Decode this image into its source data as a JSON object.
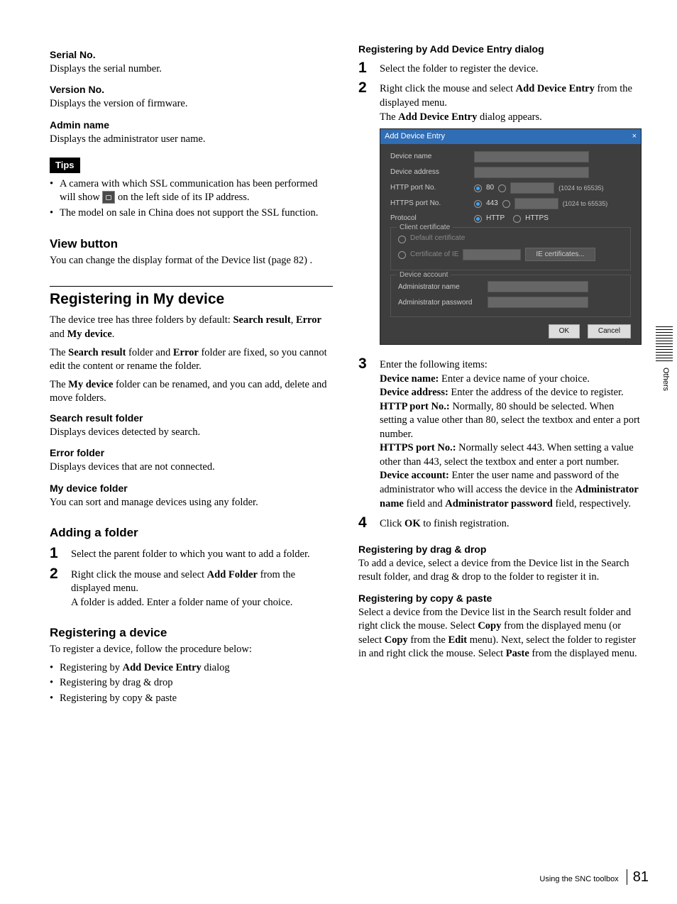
{
  "left": {
    "serial_no": {
      "term": "Serial No.",
      "body": "Displays the serial number."
    },
    "version_no": {
      "term": "Version No.",
      "body": "Displays the version of firmware."
    },
    "admin_name": {
      "term": "Admin name",
      "body": "Displays the administrator user name."
    },
    "tips_label": "Tips",
    "tips": {
      "item1_a": "A camera with which SSL communication has been performed will show ",
      "item1_b": " on the left side of its IP address.",
      "item2": "The model on sale in China does not support the SSL function."
    },
    "view_button": {
      "title": "View button",
      "body": "You can change the display format of the Device list (page 82) ."
    },
    "reg_my_device": {
      "title": "Registering in My device",
      "p1_a": "The device tree has three folders by default: ",
      "p1_b": "Search result",
      "p1_c": ", ",
      "p1_d": "Error",
      "p1_e": " and ",
      "p1_f": "My device",
      "p1_g": ".",
      "p2_a": "The ",
      "p2_b": "Search result",
      "p2_c": " folder and ",
      "p2_d": "Error",
      "p2_e": " folder are fixed, so you cannot edit the content or rename the folder.",
      "p3_a": "The ",
      "p3_b": "My device",
      "p3_c": " folder can be renamed, and you can add, delete and move folders."
    },
    "search_folder": {
      "term": "Search result folder",
      "body": "Displays devices detected by search."
    },
    "error_folder": {
      "term": "Error folder",
      "body": "Displays devices that are not connected."
    },
    "my_device_folder": {
      "term": "My device folder",
      "body": "You can sort and manage devices using any folder."
    },
    "adding_folder": {
      "title": "Adding a folder",
      "step1": "Select the parent folder to which you want to add a folder.",
      "step2_a": "Right click the mouse and select ",
      "step2_b": "Add Folder",
      "step2_c": " from the displayed menu.",
      "step2_d": "A folder is added. Enter a folder name of your choice."
    },
    "reg_device": {
      "title": "Registering a device",
      "intro": "To register a device, follow the procedure below:",
      "b1_a": "Registering by ",
      "b1_b": "Add Device Entry",
      "b1_c": " dialog",
      "b2": "Registering by drag & drop",
      "b3": "Registering by copy & paste"
    }
  },
  "right": {
    "reg_add_dialog": {
      "title": "Registering by Add Device Entry dialog",
      "step1": "Select the folder to register the device.",
      "step2_a": "Right click the mouse and select ",
      "step2_b": "Add Device Entry",
      "step2_c": " from the displayed menu.",
      "step2_d_a": "The ",
      "step2_d_b": "Add Device Entry",
      "step2_d_c": " dialog appears.",
      "step3_intro": "Enter the following items:",
      "step3_dn_a": "Device name:",
      "step3_dn_b": " Enter a device name of your choice.",
      "step3_da_a": "Device address:",
      "step3_da_b": " Enter the address of the device to register.",
      "step3_http_a": "HTTP port No.:",
      "step3_http_b": " Normally, 80 should be selected. When setting a value other than 80, select the textbox and enter a port number.",
      "step3_https_a": "HTTPS port No.:",
      "step3_https_b": " Normally select 443. When setting a value other than 443, select the textbox and enter a port number.",
      "step3_acc_a": "Device account:",
      "step3_acc_b": " Enter the user name and password of the administrator who will access the device in the ",
      "step3_acc_c": "Administrator name",
      "step3_acc_d": " field and ",
      "step3_acc_e": "Administrator password",
      "step3_acc_f": " field, respectively.",
      "step4_a": "Click ",
      "step4_b": "OK",
      "step4_c": " to finish registration."
    },
    "reg_dragdrop": {
      "title": "Registering by drag & drop",
      "body": "To add a device, select a device from the Device list in the Search result folder, and drag & drop to the folder to register it in."
    },
    "reg_copypaste": {
      "title": "Registering by copy & paste",
      "a": "Select a device from the Device list in the Search result folder and right click the mouse. Select ",
      "b": "Copy",
      "c": " from the displayed menu (or select ",
      "d": "Copy",
      "e": " from the ",
      "f": "Edit",
      "g": " menu). Next, select the folder to register in and right click the mouse. Select ",
      "h": "Paste",
      "i": " from the displayed menu."
    }
  },
  "dialog": {
    "title": "Add Device Entry",
    "close": "×",
    "device_name": "Device name",
    "device_address": "Device address",
    "http_port": "HTTP port No.",
    "http_val": "80",
    "https_port": "HTTPS port No.",
    "https_val": "443",
    "range": "(1024 to 65535)",
    "protocol": "Protocol",
    "proto_http": "HTTP",
    "proto_https": "HTTPS",
    "client_cert": "Client certificate",
    "default_cert": "Default certificate",
    "cert_of_ie": "Certificate of IE",
    "ie_cert_btn": "IE certificates...",
    "device_account": "Device account",
    "admin_name": "Administrator name",
    "admin_pw": "Administrator password",
    "ok": "OK",
    "cancel": "Cancel"
  },
  "side": {
    "label": "Others"
  },
  "footer": {
    "text": "Using the SNC toolbox",
    "page": "81"
  }
}
